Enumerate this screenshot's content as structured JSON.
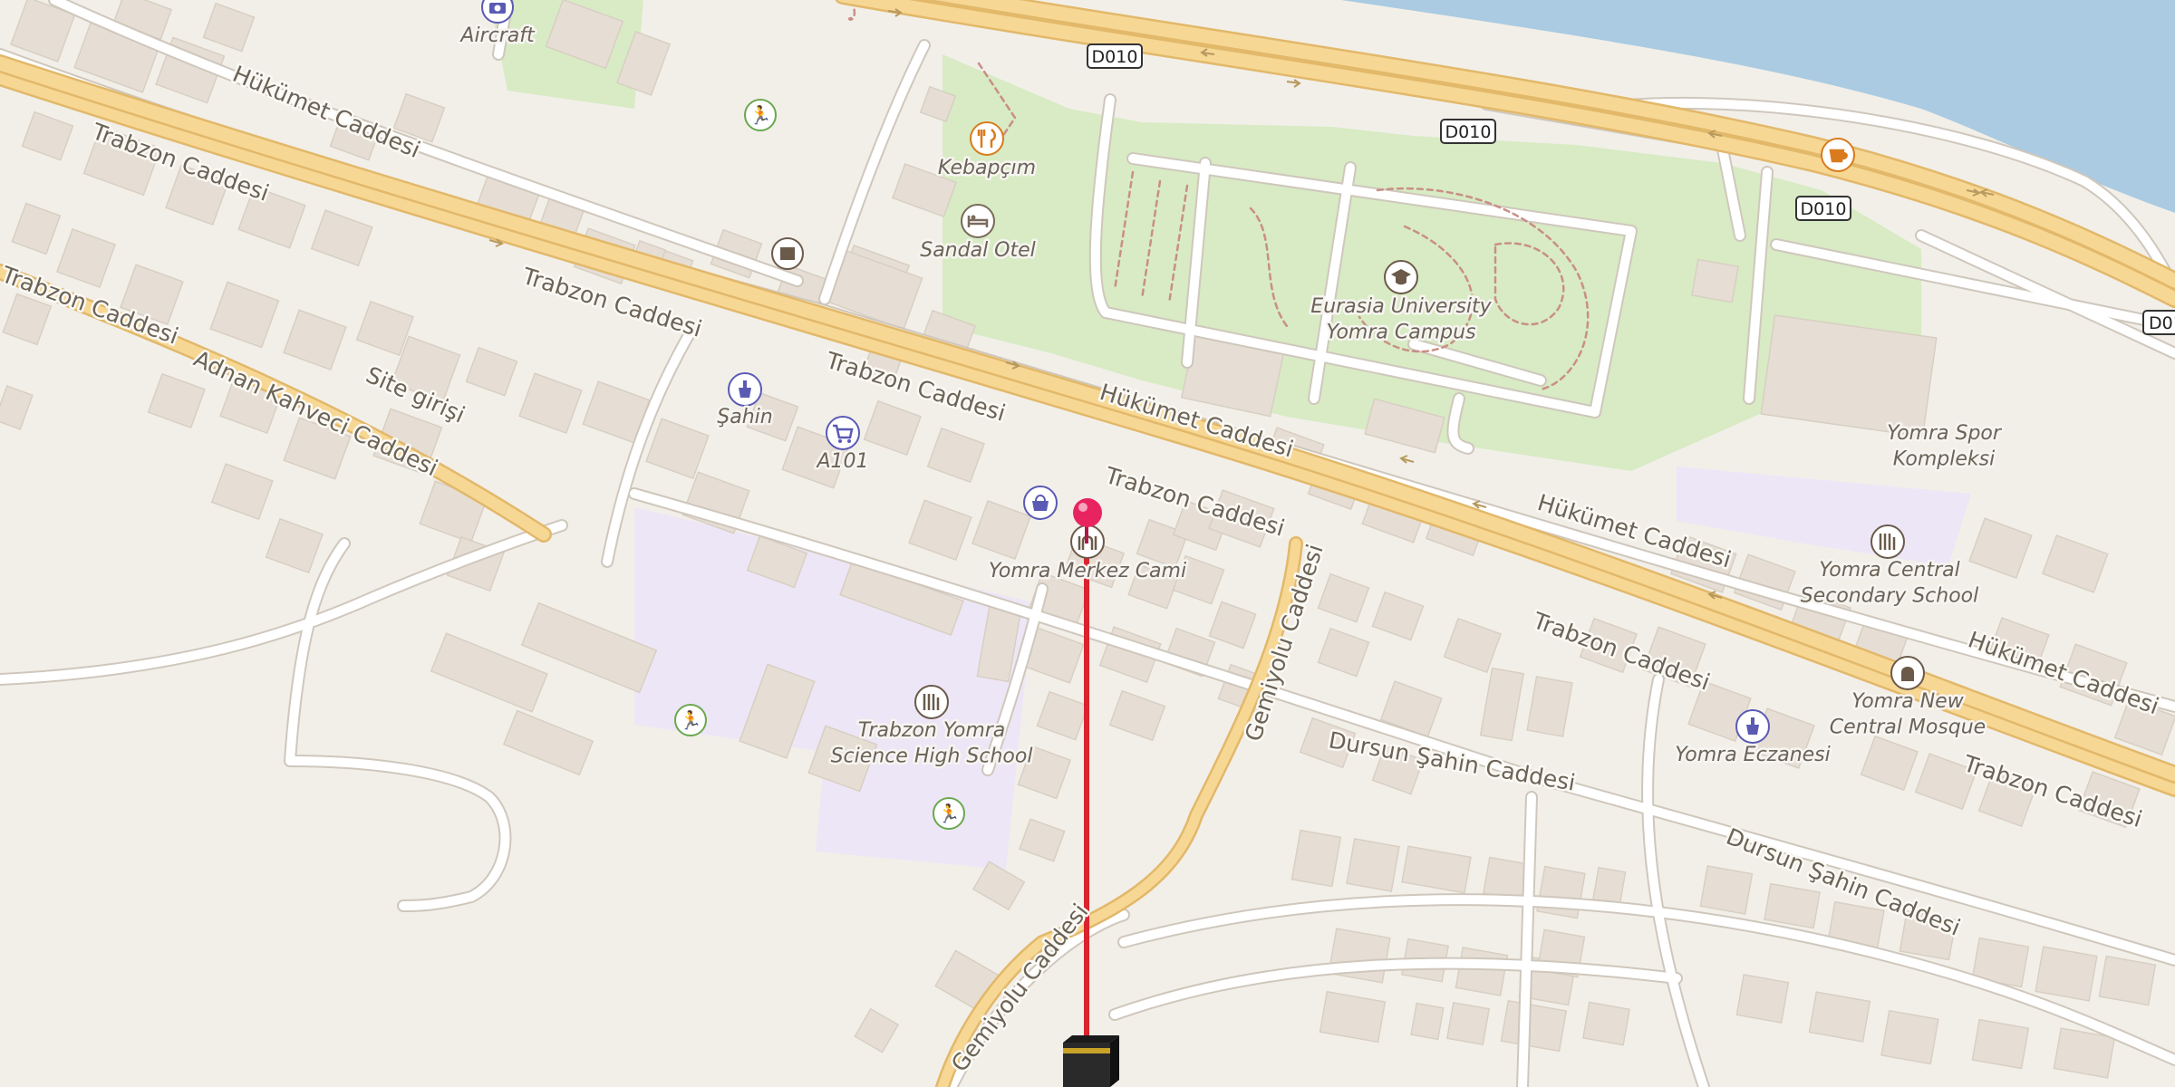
{
  "map": {
    "colors": {
      "background": "#f2efe9",
      "water": "#aacbe1",
      "park": "#d8ebc4",
      "school": "#ede6f6",
      "building": "#e6ded4",
      "major_road": "#f7d794",
      "major_road_casing": "#e2b86a",
      "minor_road": "#ffffff",
      "route_line": "#d9232e",
      "pin": "#e8245f"
    },
    "road_shields": [
      {
        "text": "D010"
      },
      {
        "text": "D010"
      },
      {
        "text": "D010"
      },
      {
        "text": "D01"
      }
    ],
    "streets": [
      {
        "name": "Hükümet Caddesi"
      },
      {
        "name": "Trabzon Caddesi"
      },
      {
        "name": "Trabzon Caddesi"
      },
      {
        "name": "Trabzon Caddesi"
      },
      {
        "name": "Trabzon Caddesi"
      },
      {
        "name": "Hükümet Caddesi"
      },
      {
        "name": "Trabzon Caddesi"
      },
      {
        "name": "Hükümet Caddesi"
      },
      {
        "name": "Trabzon Caddesi"
      },
      {
        "name": "Hükümet Caddesi"
      },
      {
        "name": "Trabzon Caddesi"
      },
      {
        "name": "Adnan Kahveci Caddesi"
      },
      {
        "name": "Site girişi"
      },
      {
        "name": "Gemiyolu Caddesi"
      },
      {
        "name": "Gemiyolu Caddesi"
      },
      {
        "name": "Dursun Şahin Caddesi"
      },
      {
        "name": "Dursun Şahin Caddesi"
      }
    ],
    "pois": [
      {
        "label": "Aircraft",
        "icon": "camera-icon"
      },
      {
        "label": "Kebapçım",
        "icon": "restaurant-icon"
      },
      {
        "label": "Sandal Otel",
        "icon": "hotel-icon"
      },
      {
        "label": "Eurasia University\nYomra Campus",
        "icon": "university-icon"
      },
      {
        "label": "Şahin",
        "icon": "pharmacy-icon"
      },
      {
        "label": "A101",
        "icon": "shopping-cart-icon"
      },
      {
        "label": "Yomra Merkez Cami",
        "icon": "mosque-icon"
      },
      {
        "label": "Yomra Spor\nKompleksi",
        "icon": ""
      },
      {
        "label": "Yomra Central\nSecondary School",
        "icon": "school-icon"
      },
      {
        "label": "Yomra New\nCentral Mosque",
        "icon": "mosque-icon"
      },
      {
        "label": "Yomra Eczanesi",
        "icon": "pharmacy-icon"
      },
      {
        "label": "Trabzon Yomra\nScience High School",
        "icon": "school-icon"
      }
    ],
    "extra_icons": [
      "sports-icon",
      "sports-icon",
      "sports-icon",
      "cafe-icon",
      "shop-icon",
      "marketplace-icon"
    ]
  }
}
